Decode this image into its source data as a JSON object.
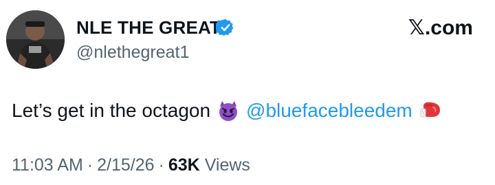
{
  "author": {
    "display_name": "NLE THE GREAT",
    "handle": "@nlethegreat1",
    "verified_icon": "verified-badge-icon",
    "avatar_icon": "profile-avatar"
  },
  "brand": {
    "label": "𝕏.com"
  },
  "tweet": {
    "text_before": "Let’s get in the octagon",
    "emoji_1": "smiling-devil-emoji",
    "mention": "@bluefacebleedem",
    "emoji_2": "boxing-glove-emoji"
  },
  "meta": {
    "time": "11:03 AM",
    "separator_1": "·",
    "date": "2/15/26",
    "separator_2": "·",
    "views_count": "63K",
    "views_label": "Views"
  },
  "colors": {
    "text": "#0f1419",
    "secondary": "#536471",
    "link": "#1d9bf0",
    "verified": "#1d9bf0"
  }
}
